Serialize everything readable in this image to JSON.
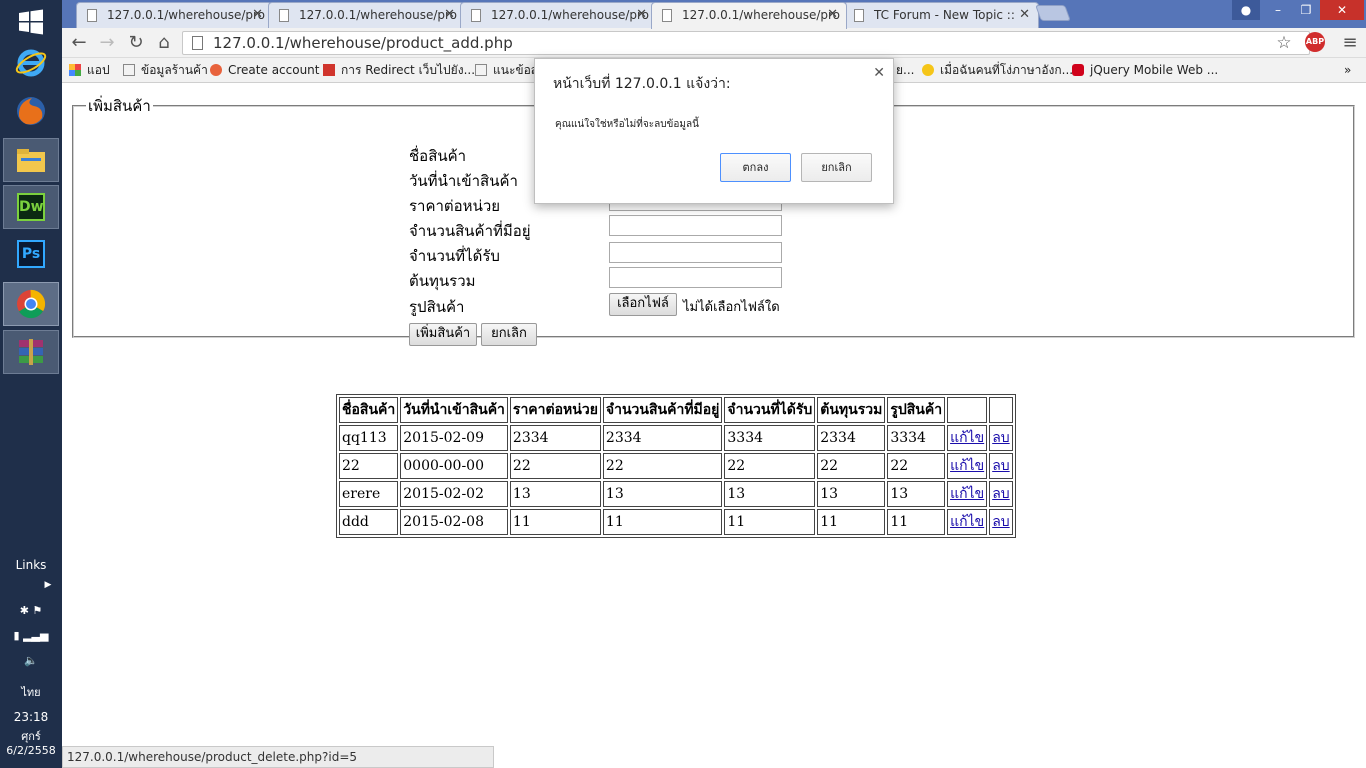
{
  "browser": {
    "tabs": [
      {
        "title": "127.0.0.1/wherehouse/pro",
        "active": false
      },
      {
        "title": "127.0.0.1/wherehouse/pro",
        "active": false
      },
      {
        "title": "127.0.0.1/wherehouse/pro",
        "active": false
      },
      {
        "title": "127.0.0.1/wherehouse/pro",
        "active": true
      },
      {
        "title": "TC Forum - New Topic :: ",
        "active": false
      }
    ],
    "url": "127.0.0.1/wherehouse/product_add.php",
    "bookmarks": [
      {
        "label": "แอป",
        "icon": "apps-grid-icon"
      },
      {
        "label": "ข้อมูลร้านค้า",
        "icon": "page-icon"
      },
      {
        "label": "Create account",
        "icon": "create-account-icon"
      },
      {
        "label": "การ Redirect เว็บไปยัง...",
        "icon": "g-icon"
      },
      {
        "label": "แนะข้อสอ",
        "icon": "page-icon"
      },
      {
        "label": "ย...",
        "icon": "page-icon"
      },
      {
        "label": "เมื่อฉันคนที่โง่ภาษาอังก...",
        "icon": "smiley-icon"
      },
      {
        "label": "jQuery Mobile Web ...",
        "icon": "youtube-icon"
      }
    ],
    "status_url": "127.0.0.1/wherehouse/product_delete.php?id=5"
  },
  "taskbar": {
    "links_label": "Links",
    "language": "ไทย",
    "time": "23:18",
    "day": "ศุกร์",
    "date": "6/2/2558"
  },
  "form": {
    "legend": "เพิ่มสินค้า",
    "labels": [
      "ชื่อสินค้า",
      "วันที่นำเข้าสินค้า",
      "ราคาต่อหน่วย",
      "จำนวนสินค้าที่มีอยู่",
      "จำนวนที่ได้รับ",
      "ต้นทุนรวม",
      "รูปสินค้า"
    ],
    "file_button": "เลือกไฟล์",
    "no_file_text": "ไม่ได้เลือกไฟล์ใด",
    "submit_label": "เพิ่มสินค้า",
    "cancel_label": "ยกเลิก"
  },
  "table": {
    "headers": [
      "ชื่อสินค้า",
      "วันที่นำเข้าสินค้า",
      "ราคาต่อหน่วย",
      "จำนวนสินค้าที่มีอยู่",
      "จำนวนที่ได้รับ",
      "ต้นทุนรวม",
      "รูปสินค้า",
      "",
      ""
    ],
    "rows": [
      {
        "name": "qq113",
        "date": "2015-02-09",
        "price": "2334",
        "stock": "2334",
        "received": "3334",
        "cost": "2334",
        "image": "3334",
        "edit": "แก้ไข",
        "delete": "ลบ"
      },
      {
        "name": "22",
        "date": "0000-00-00",
        "price": "22",
        "stock": "22",
        "received": "22",
        "cost": "22",
        "image": "22",
        "edit": "แก้ไข",
        "delete": "ลบ"
      },
      {
        "name": "erere",
        "date": "2015-02-02",
        "price": "13",
        "stock": "13",
        "received": "13",
        "cost": "13",
        "image": "13",
        "edit": "แก้ไข",
        "delete": "ลบ"
      },
      {
        "name": "ddd",
        "date": "2015-02-08",
        "price": "11",
        "stock": "11",
        "received": "11",
        "cost": "11",
        "image": "11",
        "edit": "แก้ไข",
        "delete": "ลบ"
      }
    ]
  },
  "dialog": {
    "title": "หน้าเว็บที่ 127.0.0.1 แจ้งว่า:",
    "message": "คุณแน่ใจใช่หรือไม่ที่จะลบข้อมูลนี้",
    "ok_label": "ตกลง",
    "cancel_label": "ยกเลิก"
  }
}
